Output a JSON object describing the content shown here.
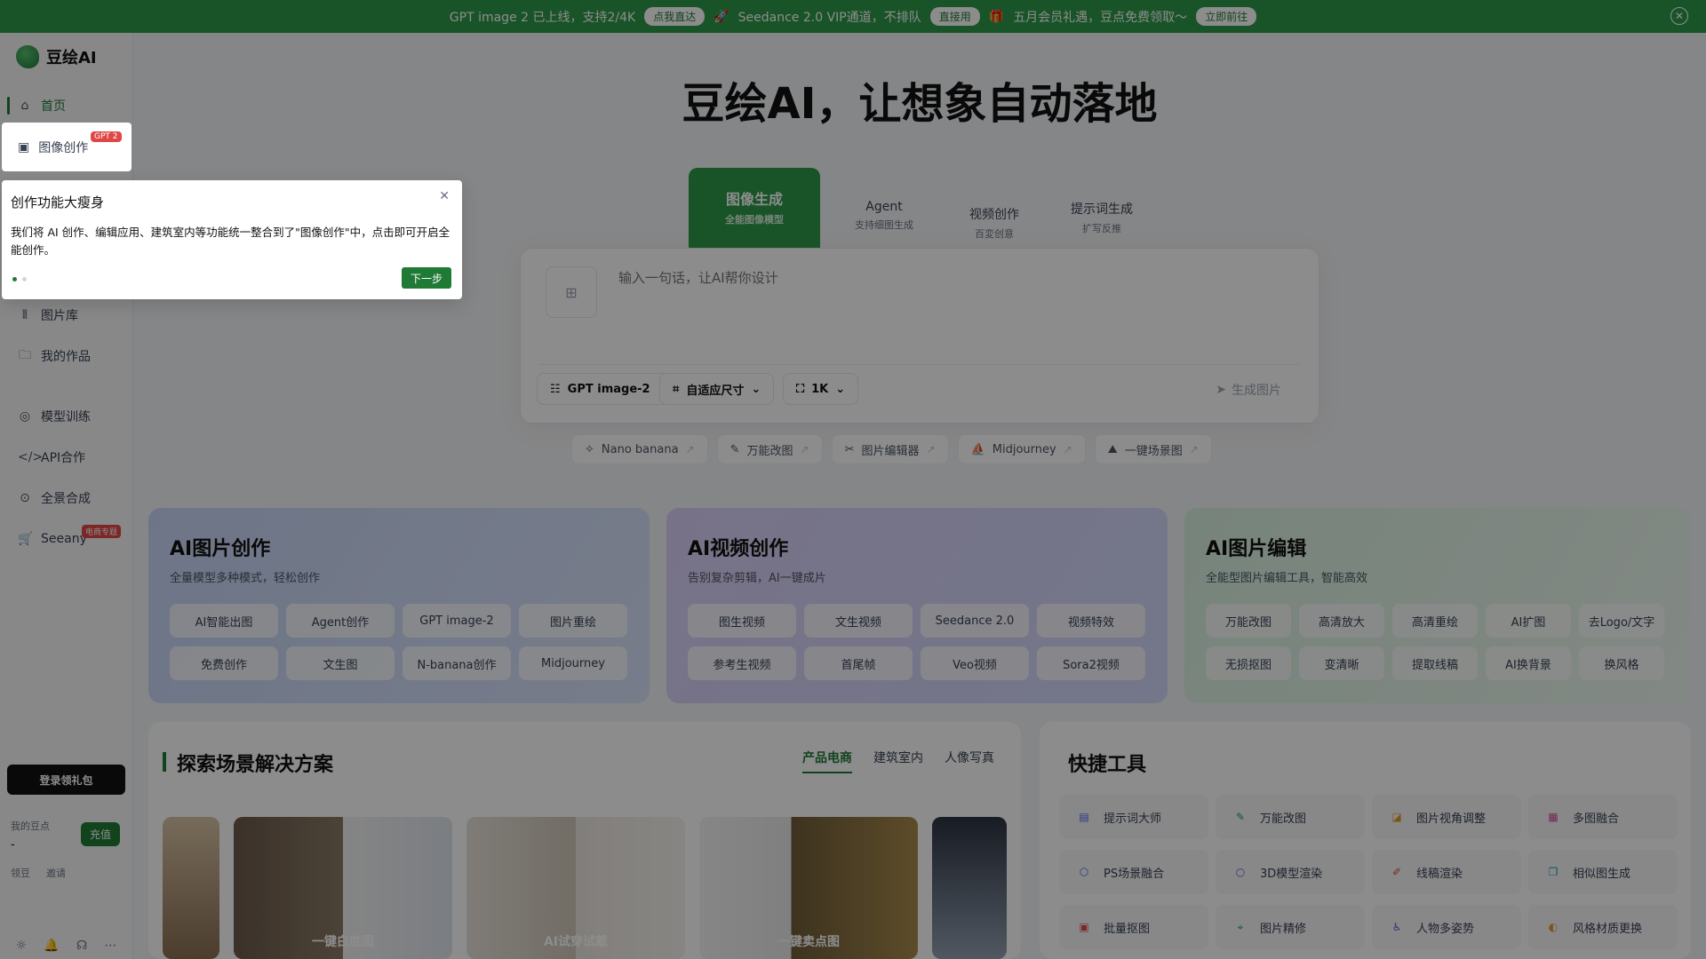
{
  "banner": {
    "text1": "GPT image 2 已上线，支持2/4K",
    "btn1": "点我直达",
    "text2": "Seedance 2.0 VIP通道，不排队",
    "btn2": "直接用",
    "text3": "五月会员礼遇，豆点免费领取～",
    "btn3": "立即前往"
  },
  "sidebar": {
    "brand": "豆绘AI",
    "items": [
      {
        "label": "首页"
      },
      {
        "label": "图像创作",
        "badge": "GPT 2"
      },
      {
        "label": "图片库"
      },
      {
        "label": "我的作品"
      },
      {
        "label": "模型训练"
      },
      {
        "label": "API合作"
      },
      {
        "label": "全景合成"
      },
      {
        "label": "Seeany",
        "badge": "电商专题"
      }
    ],
    "login": "登录领礼包",
    "points_label": "我的豆点",
    "points_value": "-",
    "recharge": "充值",
    "claim": "领豆",
    "invite": "邀请"
  },
  "hero": {
    "title": "豆绘AI，让想象自动落地",
    "tabs": [
      {
        "label": "图像生成",
        "sub": "全能图像模型"
      },
      {
        "label": "Agent",
        "sub": "支持细图生成"
      },
      {
        "label": "视频创作",
        "sub": "百変创意"
      },
      {
        "label": "提示词生成",
        "sub": "扩写反推"
      }
    ],
    "placeholder": "输入一句话，让AI帮你设计",
    "model": "GPT image-2",
    "size": "自适应尺寸",
    "resolution": "1K",
    "generate": "生成图片",
    "quick": [
      "Nano banana",
      "万能改图",
      "图片编辑器",
      "Midjourney",
      "一键场景图"
    ]
  },
  "cards": [
    {
      "title": "AI图片创作",
      "desc": "全量模型多种模式，轻松创作",
      "tags": [
        "AI智能出图",
        "Agent创作",
        "GPT image-2",
        "图片重绘",
        "免费创作",
        "文生图",
        "N-banana创作",
        "Midjourney"
      ]
    },
    {
      "title": "AI视频创作",
      "desc": "告别复杂剪辑，AI一键成片",
      "tags": [
        "图生视频",
        "文生视频",
        "Seedance 2.0",
        "视频特效",
        "参考生视频",
        "首尾帧",
        "Veo视频",
        "Sora2视频"
      ]
    },
    {
      "title": "AI图片编辑",
      "desc": "全能型图片编辑工具，智能高效",
      "tags": [
        "万能改图",
        "高清放大",
        "高清重绘",
        "AI扩图",
        "去Logo/文字",
        "无损抠图",
        "变清晰",
        "提取线稿",
        "AI换背景",
        "换风格"
      ]
    }
  ],
  "scene": {
    "title": "探索场景解决方案",
    "tabs": [
      "产品电商",
      "建筑室内",
      "人像写真"
    ],
    "tiles": [
      "一键白底图",
      "AI试穿试戴",
      "一键卖点图"
    ]
  },
  "tools": {
    "title": "快捷工具",
    "items": [
      "提示词大师",
      "万能改图",
      "图片视角调整",
      "多图融合",
      "PS场景融合",
      "3D模型渲染",
      "线稿渲染",
      "相似图生成",
      "批量抠图",
      "图片精修",
      "人物多姿势",
      "风格材质更换"
    ]
  },
  "popover": {
    "title": "创作功能大瘦身",
    "text": "我们将 AI 创作、编辑应用、建筑室内等功能统一整合到了\"图像创作\"中，点击即可开启全能创作。",
    "next": "下一步"
  },
  "colors": {
    "brand": "#1f7a36",
    "banner": "#2f9a4a"
  }
}
